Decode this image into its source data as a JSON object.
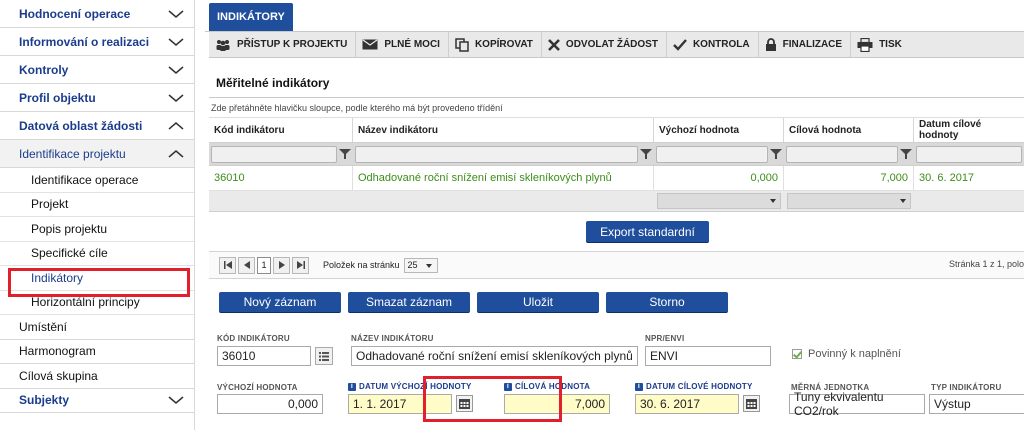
{
  "sidebar": {
    "items": [
      {
        "label": "Hodnocení operace"
      },
      {
        "label": "Informování o realizaci"
      },
      {
        "label": "Kontroly"
      },
      {
        "label": "Profil objektu"
      },
      {
        "label": "Datová oblast žádosti"
      },
      {
        "label": "Identifikace projektu"
      }
    ],
    "subitems": [
      {
        "label": "Identifikace operace"
      },
      {
        "label": "Projekt"
      },
      {
        "label": "Popis projektu"
      },
      {
        "label": "Specifické cíle"
      },
      {
        "label": "Indikátory"
      },
      {
        "label": "Horizontální principy"
      }
    ],
    "bottom_items": [
      {
        "label": "Umístění"
      },
      {
        "label": "Harmonogram"
      },
      {
        "label": "Cílová skupina"
      },
      {
        "label": "Subjekty"
      }
    ]
  },
  "tab": {
    "label": "INDIKÁTORY"
  },
  "toolbar": {
    "buttons": [
      {
        "label": "PŘÍSTUP K PROJEKTU",
        "icon": "people-icon"
      },
      {
        "label": "PLNÉ MOCI",
        "icon": "envelope-icon"
      },
      {
        "label": "KOPÍROVAT",
        "icon": "copy-icon"
      },
      {
        "label": "ODVOLAT ŽÁDOST",
        "icon": "x-icon"
      },
      {
        "label": "KONTROLA",
        "icon": "checkmark-icon"
      },
      {
        "label": "FINALIZACE",
        "icon": "lock-icon"
      },
      {
        "label": "TISK",
        "icon": "printer-icon"
      }
    ]
  },
  "section": {
    "title": "Měřitelné indikátory"
  },
  "grid": {
    "hint": "Zde přetáhněte hlavičku sloupce, podle kterého má být provedeno třídění",
    "columns": [
      "Kód indikátoru",
      "Název indikátoru",
      "Výchozí hodnota",
      "Cílová hodnota",
      "Datum cílové hodnoty"
    ],
    "rows": [
      {
        "kod": "36010",
        "nazev": "Odhadované roční snížení emisí skleníkových plynů",
        "vychozi": "0,000",
        "cilova": "7,000",
        "datum": "30. 6. 2017"
      }
    ]
  },
  "export": {
    "label": "Export standardní"
  },
  "pager": {
    "current_page": "1",
    "per_page_label": "Položek na stránku",
    "per_page_value": "25",
    "info": "Stránka 1 z 1, polo"
  },
  "actions": {
    "new": "Nový záznam",
    "delete": "Smazat záznam",
    "save": "Uložit",
    "cancel": "Storno"
  },
  "form": {
    "kod_label": "KÓD INDIKÁTORU",
    "kod_value": "36010",
    "nazev_label": "NÁZEV INDIKÁTORU",
    "nazev_value": "Odhadované roční snížení emisí skleníkových plynů",
    "npr_label": "NPR/ENVI",
    "npr_value": "ENVI",
    "povinny_label": "Povinný k naplnění",
    "vychozi_label": "VÝCHOZÍ HODNOTA",
    "vychozi_value": "0,000",
    "datum_vychozi_label": "DATUM VÝCHOZÍ HODNOTY",
    "datum_vychozi_value": "1. 1. 2017",
    "cilova_label": "CÍLOVÁ HODNOTA",
    "cilova_value": "7,000",
    "datum_cilove_label": "DATUM CÍLOVÉ HODNOTY",
    "datum_cilove_value": "30. 6. 2017",
    "jednotka_label": "MĚRNÁ JEDNOTKA",
    "jednotka_value": "Tuny ekvivalentu CO2/rok",
    "typ_label": "TYP INDIKÁTORU",
    "typ_value": "Výstup"
  },
  "colors": {
    "brand_blue": "#1f4e9c",
    "highlight_red": "#e0202a",
    "row_green": "#3d8d1a",
    "required_yellow": "#fffcc7"
  }
}
